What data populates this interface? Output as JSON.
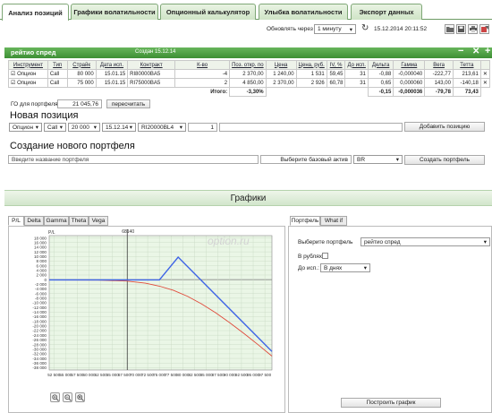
{
  "tabs": [
    {
      "label": "Анализ позиций"
    },
    {
      "label": "Графики волатильности"
    },
    {
      "label": "Опционный калькулятор"
    },
    {
      "label": "Улыбка волатильности"
    },
    {
      "label": "Экспорт данных"
    }
  ],
  "toolbar": {
    "refresh_label": "Обновлять через",
    "refresh_value": "1 минуту",
    "datetime": "15.12.2014 20:11:52",
    "icons": [
      "open-folder-icon",
      "save-icon",
      "print-icon",
      "export-icon"
    ]
  },
  "portfolio": {
    "title": "рейтио спред",
    "created": "Создан 15.12.14",
    "columns": [
      "Инструмент",
      "Тип",
      "Страйк",
      "Дата исп.",
      "Контракт",
      "К-во",
      "Поз. откр. по",
      "Цена",
      "Цена, руб.",
      "IV, %",
      "До исп.",
      "Дельта",
      "Гамма",
      "Вега",
      "Тетта"
    ],
    "rows": [
      [
        "Опцион",
        "Call",
        "80 000",
        "15.01.15",
        "RI80000BA5",
        "-4",
        "2 370,00",
        "1 240,00",
        "1 531",
        "59,45",
        "31",
        "-0,88",
        "-0,000040",
        "-222,77",
        "213,61"
      ],
      [
        "Опцион",
        "Call",
        "75 000",
        "15.01.15",
        "RI75000BA5",
        "2",
        "4 850,00",
        "2 370,00",
        "2 926",
        "60,78",
        "31",
        "0,65",
        "0,000060",
        "143,00",
        "-140,18"
      ]
    ],
    "total_label": "Итого:",
    "total_pct": "-3,30%",
    "total_delta": "-0,15",
    "total_gamma": "-0,000036",
    "total_vega": "-79,78",
    "total_theta": "73,43",
    "go_label": "ГО для портфеля:",
    "go_value": "21 045,76",
    "recalc_button": "пересчитать"
  },
  "new_position": {
    "heading": "Новая позиция",
    "type": "Опцион",
    "option_kind": "Call",
    "strike": "20 000",
    "date": "15.12.14",
    "contract": "RI20000BL4",
    "qty": "1",
    "add_button": "Добавить позицию"
  },
  "new_portfolio": {
    "heading": "Создание нового портфеля",
    "name_placeholder": "Введите название портфеля",
    "base_asset_label": "Выберите базовый актив",
    "base_asset_value": "BR",
    "create_button": "Создать портфель"
  },
  "graphs": {
    "heading": "Графики",
    "tabs": [
      "P/L",
      "Delta",
      "Gamma",
      "Theta",
      "Vega"
    ],
    "watermark": "option.ru",
    "ylabel": "P/L",
    "marker_label": "68140",
    "zoom_icons": [
      "zoom-in-icon",
      "zoom-out-icon",
      "zoom-reset-icon"
    ]
  },
  "side": {
    "tabs": [
      "Портфель",
      "What if"
    ],
    "portfolio_label": "Выберите портфель",
    "portfolio_value": "рейтио спред",
    "rub_label": "В рублях:",
    "until_label": "До исп.:",
    "until_value": "В днях",
    "build_button": "Построить график"
  },
  "chart_data": {
    "type": "line",
    "ylabel": "P/L",
    "x_ticks": [
      "52 500",
      "55 000",
      "57 500",
      "60 000",
      "62 500",
      "65 000",
      "67 500",
      "70 000",
      "72 500",
      "75 000",
      "77 500",
      "80 000",
      "82 500",
      "85 000",
      "87 500",
      "90 000",
      "92 500",
      "95 000",
      "97 500"
    ],
    "y_ticks": [
      "18 000",
      "16 000",
      "14 000",
      "12 000",
      "10 000",
      "8 000",
      "6 000",
      "4 000",
      "2 000",
      "0",
      "-2 000",
      "-4 000",
      "-6 000",
      "-8 000",
      "-10 000",
      "-12 000",
      "-14 000",
      "-16 000",
      "-18 000",
      "-20 000",
      "-22 000",
      "-24 000",
      "-26 000",
      "-28 000",
      "-30 000",
      "-32 000",
      "-34 000",
      "-36 000",
      "-38 000"
    ],
    "xlim": [
      51500,
      99000
    ],
    "ylim": [
      -39000,
      19000
    ],
    "marker_x": 68140,
    "series": [
      {
        "color": "#3d63e6",
        "x": [
          51500,
          75000,
          79000,
          99000
        ],
        "y": [
          -100,
          -100,
          9700,
          -31000
        ]
      },
      {
        "color": "#e04a3b",
        "x": [
          51500,
          62000,
          68000,
          72000,
          75000,
          78000,
          81000,
          84000,
          87000,
          90000,
          93000,
          96000,
          99000
        ],
        "y": [
          -150,
          -200,
          -600,
          -1500,
          -2800,
          -4600,
          -7200,
          -10500,
          -14300,
          -18600,
          -23200,
          -28000,
          -33000
        ]
      }
    ]
  }
}
